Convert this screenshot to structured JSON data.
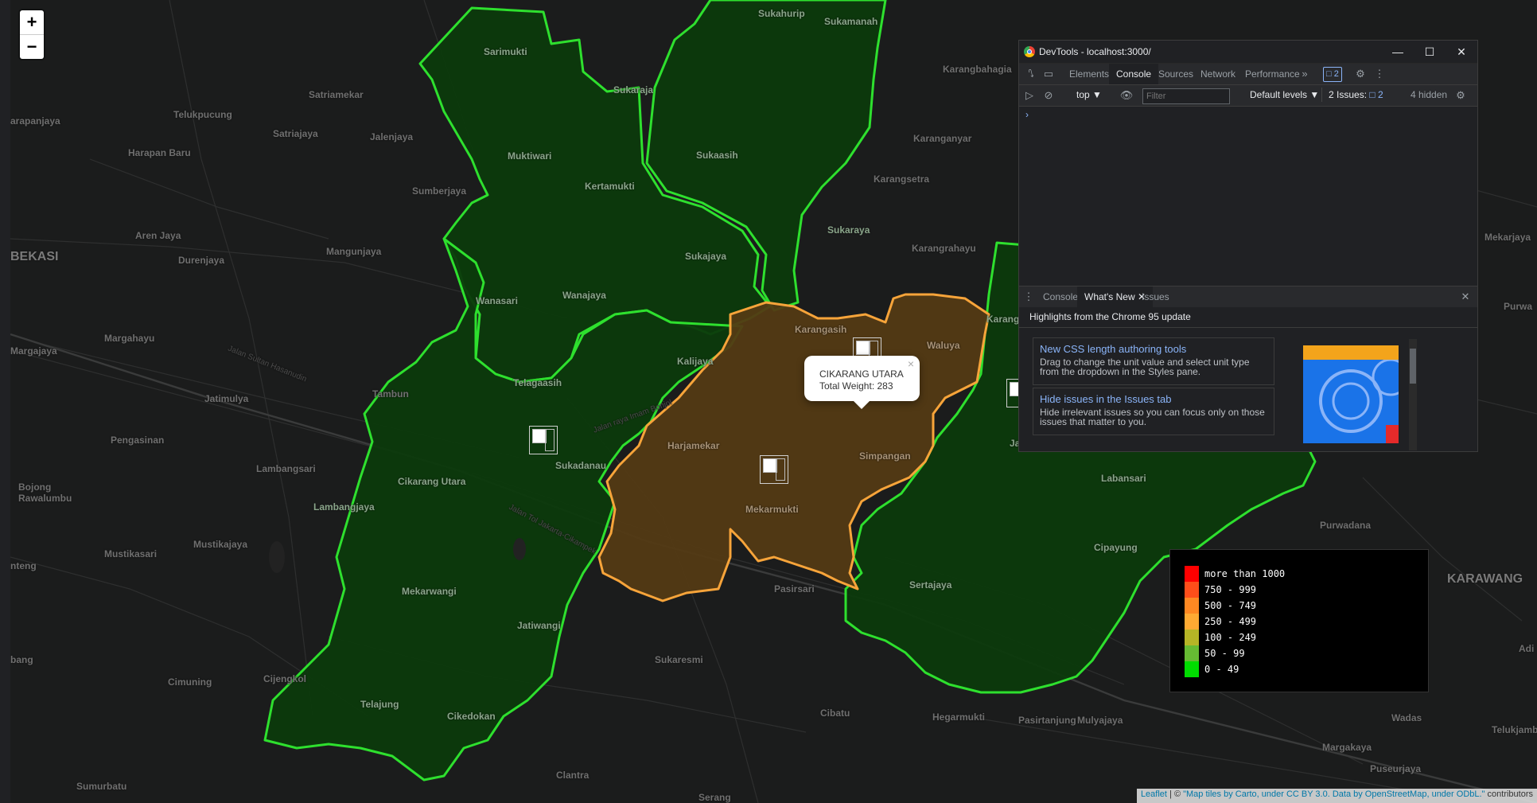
{
  "map": {
    "zoom_in": "+",
    "zoom_out": "−",
    "popup": {
      "name": "CIKARANG UTARA",
      "weight": "Total Weight: 283",
      "close": "×"
    },
    "labels": [
      {
        "text": "Sukahurip"
      },
      {
        "text": "Sukamanah"
      },
      {
        "text": "Sarimukti"
      },
      {
        "text": "Satriamekar"
      },
      {
        "text": "Telukpucung"
      },
      {
        "text": "Satriajaya"
      },
      {
        "text": "Jalenjaya"
      },
      {
        "text": "arapanjaya"
      },
      {
        "text": "Harapan Baru"
      },
      {
        "text": "Muktiwari"
      },
      {
        "text": "Kertamukti"
      },
      {
        "text": "Sukaasih"
      },
      {
        "text": "Sumberjaya"
      },
      {
        "text": "Karangbahagia"
      },
      {
        "text": "Karanganyar"
      },
      {
        "text": "Karangsetra"
      },
      {
        "text": "Sukaraya"
      },
      {
        "text": "Karangrahayu"
      },
      {
        "text": "Mekarjaya"
      },
      {
        "text": "Aren Jaya"
      },
      {
        "text": "BEKASI"
      },
      {
        "text": "Durenjaya"
      },
      {
        "text": "Mangunjaya"
      },
      {
        "text": "Sukajaya"
      },
      {
        "text": "Wanasari"
      },
      {
        "text": "Wanajaya"
      },
      {
        "text": "Margajaya"
      },
      {
        "text": "Margahayu"
      },
      {
        "text": "Karangasih"
      },
      {
        "text": "Waluya"
      },
      {
        "text": "Kalijaya"
      },
      {
        "text": "Telagaasih"
      },
      {
        "text": "Tambun"
      },
      {
        "text": "Jatimulya"
      },
      {
        "text": "Pengasinan"
      },
      {
        "text": "Harjamekar"
      },
      {
        "text": "Simpangan"
      },
      {
        "text": "Jatibaru"
      },
      {
        "text": "Sukadanau"
      },
      {
        "text": "Lambangsari"
      },
      {
        "text": "Bojong Rawalumbu"
      },
      {
        "text": "Lambangjaya"
      },
      {
        "text": "Mekarmukti"
      },
      {
        "text": "Labansari"
      },
      {
        "text": "Mustikajaya"
      },
      {
        "text": "Purwadana"
      },
      {
        "text": "Mustikasari"
      },
      {
        "text": "Cipayung"
      },
      {
        "text": "Sertajaya"
      },
      {
        "text": "Mekarwangi"
      },
      {
        "text": "Pasirsari"
      },
      {
        "text": "KARAWANG"
      },
      {
        "text": "Jatiwangi"
      },
      {
        "text": "Sukaresmi"
      },
      {
        "text": "Cimuning"
      },
      {
        "text": "Cijengkol"
      },
      {
        "text": "Telajung"
      },
      {
        "text": "Cikedokan"
      },
      {
        "text": "Cibatu"
      },
      {
        "text": "Hegarmukti"
      },
      {
        "text": "Pasirtanjung"
      },
      {
        "text": "Mulyajaya"
      },
      {
        "text": "Wadas"
      },
      {
        "text": "Margakaya"
      },
      {
        "text": "Telukjambe"
      },
      {
        "text": "Sumurbatu"
      },
      {
        "text": "Clantra"
      },
      {
        "text": "Serang"
      },
      {
        "text": "Puseurjaya"
      },
      {
        "text": "Sukaraja"
      },
      {
        "text": "Purwa"
      },
      {
        "text": "Karang"
      },
      {
        "text": "Adi"
      },
      {
        "text": "nteng"
      },
      {
        "text": "bang"
      },
      {
        "text": "Jalan Sultan Hasanudin"
      },
      {
        "text": "Jalan Tol Jakarta-Cikampek"
      },
      {
        "text": "Jalan raya Imam Bonjol"
      },
      {
        "text": "Cikarang Utara"
      }
    ],
    "attribution": {
      "leaflet": "Leaflet",
      "sep": " | © ",
      "carto": "\"Map tiles by Carto, under CC BY 3.0. Data by OpenStreetMap, under ODbL.\"",
      "tail": " contributors"
    }
  },
  "legend": {
    "items": [
      {
        "label": "more than 1000",
        "color": "#ff0000"
      },
      {
        "label": "750 - 999",
        "color": "#ff4e1a"
      },
      {
        "label": "500 - 749",
        "color": "#ff8822"
      },
      {
        "label": "250 - 499",
        "color": "#ffaa33"
      },
      {
        "label": "100 - 249",
        "color": "#b5b526"
      },
      {
        "label": "50 - 99",
        "color": "#66bb33"
      },
      {
        "label": "0 - 49",
        "color": "#00dd00"
      }
    ]
  },
  "devtools": {
    "title": "DevTools - localhost:3000/",
    "tabs": [
      {
        "label": "Elements"
      },
      {
        "label": "Console",
        "active": true
      },
      {
        "label": "Sources"
      },
      {
        "label": "Network"
      },
      {
        "label": "Performance"
      }
    ],
    "more_tabs": "»",
    "message_badge": "2",
    "context": "top ▼",
    "filter_placeholder": "Filter",
    "levels": "Default levels ▼",
    "issues": "2 Issues:",
    "issues_badge": "2",
    "hidden": "4 hidden",
    "prompt": "›",
    "drawer_tabs": [
      {
        "label": "Console"
      },
      {
        "label": "What's New",
        "active": true
      },
      {
        "label": "Issues"
      }
    ],
    "drawer_heading": "Highlights from the Chrome 95 update",
    "cards": [
      {
        "title": "New CSS length authoring tools",
        "desc": "Drag to change the unit value and select unit type from the dropdown in the Styles pane."
      },
      {
        "title": "Hide issues in the Issues tab",
        "desc": "Hide irrelevant issues so you can focus only on those issues that matter to you."
      }
    ]
  }
}
